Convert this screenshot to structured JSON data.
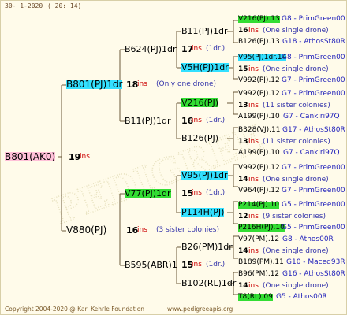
{
  "header": {
    "date": "30-  1-2020",
    "time": "( 20:  14)"
  },
  "watermark": "PEDIGREE",
  "footer": {
    "copyright": "Copyright 2004-2020 @ Karl Kehrle Foundation",
    "site": "www.pedigreeapis.org"
  },
  "root": {
    "name": "B801(AK0)",
    "num": "19",
    "ins": "ins"
  },
  "gen1": [
    {
      "name": "B801(PJ)1dr",
      "num": "18",
      "ins": "ins",
      "note": "(Only one drone)"
    },
    {
      "name": "V880(PJ)",
      "num": "16",
      "ins": "ins",
      "note": "(3 sister colonies)"
    }
  ],
  "gen2": [
    {
      "name": "B624(PJ)1dr",
      "num": "17",
      "ins": "ins",
      "note": "(1dr.)"
    },
    {
      "name": "B11(PJ)1dr",
      "num": "16",
      "ins": "ins",
      "note": "(1dr.)"
    },
    {
      "name": "V77(PJ)1dr",
      "num": "15",
      "ins": "ins",
      "note": "(1dr.)"
    },
    {
      "name": "B595(ABR)1",
      "num": "15",
      "ins": "ins",
      "note": "(1dr.)"
    }
  ],
  "gen3": [
    {
      "name": "B11(PJ)1dr"
    },
    {
      "name": "V5H(PJ)1dr"
    },
    {
      "name": "V216(PJ)"
    },
    {
      "name": "B126(PJ)"
    },
    {
      "name": "V95(PJ)1dr"
    },
    {
      "name": "P114H(PJ)"
    },
    {
      "name": "B26(PM)1dr"
    },
    {
      "name": "B102(RL)1dr"
    }
  ],
  "gen4": [
    {
      "top": "V216(PJ).13",
      "top_src": "G8 - PrimGreen00",
      "mid_num": "16",
      "mid_ins": "ins",
      "mid_note": "(One single drone)",
      "bot": "B126(PJ).13",
      "bot_src": "G18 - AthosSt80R"
    },
    {
      "top": "V95(PJ)1dr.14",
      "top_src": "G8 - PrimGreen00",
      "mid_num": "15",
      "mid_ins": "ins",
      "mid_note": "(One single drone)",
      "bot": "V992(PJ).12",
      "bot_src": "G7 - PrimGreen00"
    },
    {
      "top": "V992(PJ).12",
      "top_src": "G7 - PrimGreen00",
      "mid_num": "13",
      "mid_ins": "ins",
      "mid_note": "(11 sister colonies)",
      "bot": "A199(PJ).10",
      "bot_src": "G7 - Cankiri97Q"
    },
    {
      "top": "B328(VJ).11",
      "top_src": "G17 - AthosSt80R",
      "mid_num": "13",
      "mid_ins": "ins",
      "mid_note": "(11 sister colonies)",
      "bot": "A199(PJ).10",
      "bot_src": "G7 - Cankiri97Q"
    },
    {
      "top": "V992(PJ).12",
      "top_src": "G7 - PrimGreen00",
      "mid_num": "14",
      "mid_ins": "ins",
      "mid_note": "(One single drone)",
      "bot": "V964(PJ).12",
      "bot_src": "G7 - PrimGreen00"
    },
    {
      "top": "P214(PJ).10",
      "top_src": "G5 - PrimGreen00",
      "mid_num": "12",
      "mid_ins": "ins",
      "mid_note": "(9 sister colonies)",
      "bot": "P216H(PJ).10",
      "bot_src": "G5 - PrimGreen00"
    },
    {
      "top": "V97(PM).12",
      "top_src": "G8 - Athos00R",
      "mid_num": "14",
      "mid_ins": "ins",
      "mid_note": "(One single drone)",
      "bot": "B189(PM).11",
      "bot_src": "G10 - Maced93R"
    },
    {
      "top": "B96(PM).12",
      "top_src": "G16 - AthosSt80R",
      "mid_num": "14",
      "mid_ins": "ins",
      "mid_note": "(One single drone)",
      "bot": "T8(RL).09",
      "bot_src": "G5 - Athos00R"
    }
  ]
}
